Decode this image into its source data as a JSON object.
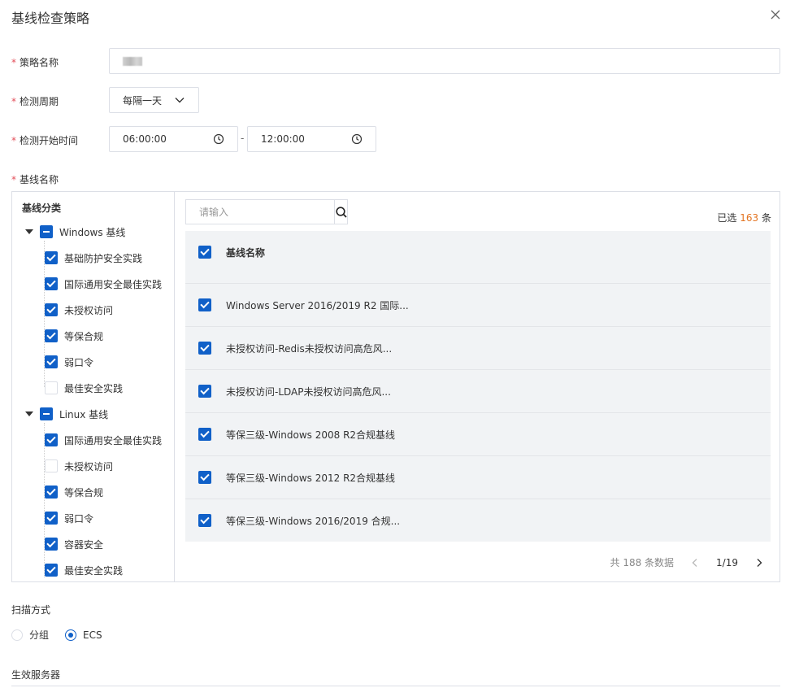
{
  "dialog": {
    "title": "基线检查策略"
  },
  "form": {
    "name_label": "策略名称",
    "period_label": "检测周期",
    "period_value": "每隔一天",
    "start_time_label": "检测开始时间",
    "time_from": "06:00:00",
    "time_to": "12:00:00",
    "time_separator": "-",
    "baseline_label": "基线名称",
    "required_mark": "*"
  },
  "tree": {
    "header": "基线分类",
    "groups": [
      {
        "label": "Windows 基线",
        "state": "indeterminate",
        "children": [
          {
            "label": "基础防护安全实践",
            "checked": true
          },
          {
            "label": "国际通用安全最佳实践",
            "checked": true
          },
          {
            "label": "未授权访问",
            "checked": true
          },
          {
            "label": "等保合规",
            "checked": true
          },
          {
            "label": "弱口令",
            "checked": true
          },
          {
            "label": "最佳安全实践",
            "checked": false
          }
        ]
      },
      {
        "label": "Linux 基线",
        "state": "indeterminate",
        "children": [
          {
            "label": "国际通用安全最佳实践",
            "checked": true
          },
          {
            "label": "未授权访问",
            "checked": false
          },
          {
            "label": "等保合规",
            "checked": true
          },
          {
            "label": "弱口令",
            "checked": true
          },
          {
            "label": "容器安全",
            "checked": true
          },
          {
            "label": "最佳安全实践",
            "checked": true
          }
        ]
      }
    ]
  },
  "search": {
    "placeholder": "请输入"
  },
  "selection": {
    "prefix": "已选",
    "count": "163",
    "suffix": "条"
  },
  "table": {
    "header": "基线名称",
    "rows": [
      "Windows Server 2016/2019 R2 国际...",
      "未授权访问-Redis未授权访问高危风...",
      "未授权访问-LDAP未授权访问高危风...",
      "等保三级-Windows 2008 R2合规基线",
      "等保三级-Windows 2012 R2合规基线",
      "等保三级-Windows 2016/2019 合规..."
    ]
  },
  "pager": {
    "total": "共 188 条数据",
    "page": "1/19"
  },
  "scan": {
    "label": "扫描方式",
    "options": [
      {
        "label": "分组",
        "selected": false
      },
      {
        "label": "ECS",
        "selected": true
      }
    ]
  },
  "effect": {
    "label": "生效服务器"
  },
  "colors": {
    "primary": "#1060c8",
    "accent": "#e37320",
    "required": "#e34d59"
  }
}
